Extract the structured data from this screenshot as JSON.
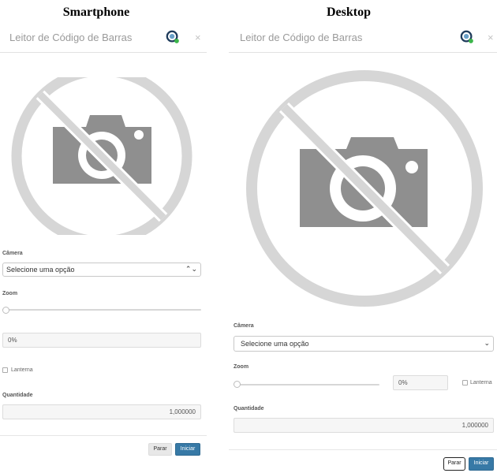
{
  "headings": {
    "left": "Smartphone",
    "right": "Desktop"
  },
  "dialog": {
    "title": "Leitor de Código de Barras",
    "icons": {
      "scanner": "barcode-scanner-icon",
      "close": "close-icon",
      "close_glyph": "×"
    },
    "camera_label": "Câmera",
    "camera_select": "Selecione uma opção",
    "zoom_label": "Zoom",
    "zoom_value": "0%",
    "flashlight_label": "Lanterna",
    "quantity_label": "Quantidade",
    "quantity_value": "1,000000",
    "stop_button": "Parar",
    "start_button": "Iniciar"
  },
  "colors": {
    "accent": "#3779a6",
    "placeholder_gray": "#9a9a9a",
    "placeholder_ring": "#d6d6d6",
    "status_dot": "#3cb54a"
  }
}
